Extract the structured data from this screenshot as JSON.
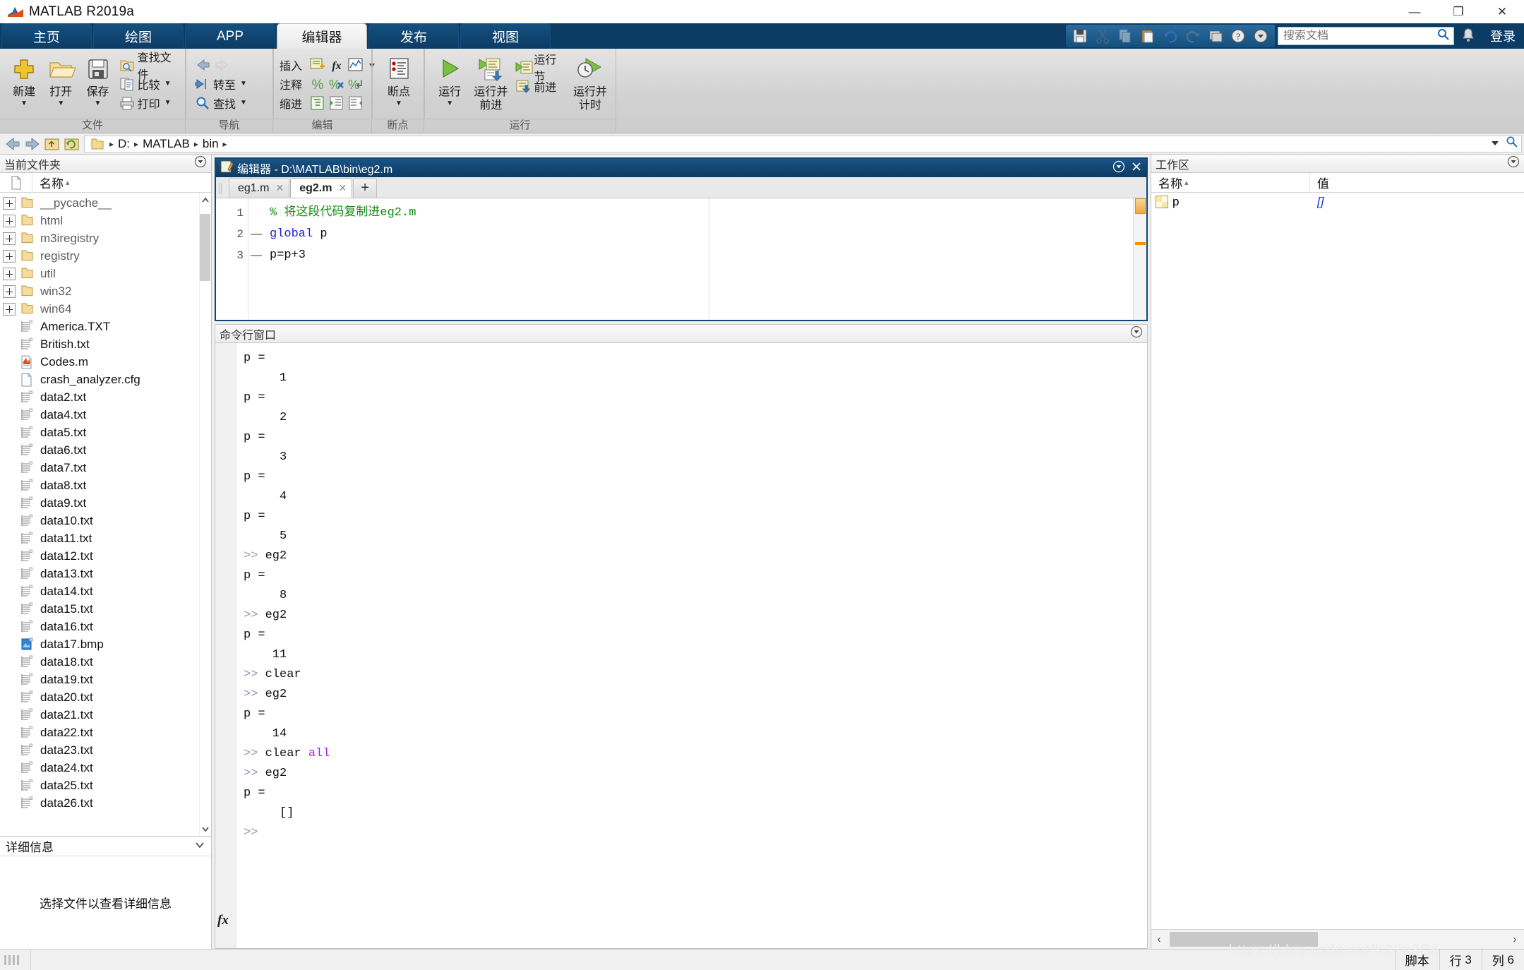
{
  "window": {
    "title": "MATLAB R2019a",
    "minimize": "—",
    "maximize": "❐",
    "close": "✕"
  },
  "ribbon": {
    "tabs": [
      {
        "label": "主页",
        "active": false
      },
      {
        "label": "绘图",
        "active": false
      },
      {
        "label": "APP",
        "active": false
      },
      {
        "label": "编辑器",
        "active": true
      },
      {
        "label": "发布",
        "active": false
      },
      {
        "label": "视图",
        "active": false
      }
    ],
    "quick_access": {
      "icons": [
        "save-icon",
        "cut-icon",
        "copy-icon",
        "paste-icon",
        "undo-icon",
        "redo-icon",
        "layout-icon",
        "help-icon",
        "more-icon"
      ],
      "search_placeholder": "搜索文档",
      "search_value": "",
      "notify_icon": "bell-icon",
      "login_label": "登录"
    },
    "groups": [
      {
        "name": "文件",
        "big_buttons": [
          {
            "label": "新建",
            "icon": "new-file-icon",
            "caret": "▼"
          },
          {
            "label": "打开",
            "icon": "open-folder-icon",
            "caret": "▼"
          },
          {
            "label": "保存",
            "icon": "save-disk-icon",
            "caret": "▼"
          }
        ],
        "small_buttons": [
          {
            "label": "查找文件",
            "icon": "find-files-icon",
            "caret": ""
          },
          {
            "label": "比较",
            "icon": "compare-icon",
            "caret": "▼"
          },
          {
            "label": "打印",
            "icon": "print-icon",
            "caret": "▼"
          }
        ]
      },
      {
        "name": "导航",
        "small_buttons": [
          {
            "label": "",
            "icon": "back-arrow-icon",
            "caret": ""
          },
          {
            "label": "转至",
            "icon": "goto-icon",
            "caret": "▼"
          },
          {
            "label": "查找",
            "icon": "search-icon",
            "caret": "▼"
          }
        ]
      },
      {
        "name": "编辑",
        "rows": [
          {
            "label": "插入",
            "icons": [
              "insert-section-icon",
              "fx-icon",
              "function-plot-icon",
              "chevron-down-icon"
            ]
          },
          {
            "label": "注释",
            "icons": [
              "comment-icon",
              "uncomment-icon",
              "wrap-comment-icon"
            ]
          },
          {
            "label": "缩进",
            "icons": [
              "smart-indent-icon",
              "indent-right-icon",
              "indent-left-icon"
            ]
          }
        ]
      },
      {
        "name": "断点",
        "big_buttons": [
          {
            "label": "断点",
            "icon": "breakpoint-icon",
            "caret": "▼"
          }
        ]
      },
      {
        "name": "运行",
        "big_buttons": [
          {
            "label": "运行",
            "icon": "run-icon",
            "caret": "▼"
          },
          {
            "label": "运行并\n前进",
            "icon": "run-advance-icon",
            "caret": ""
          },
          {
            "label": "运行并\n计时",
            "icon": "run-time-icon",
            "caret": ""
          }
        ],
        "small_buttons": [
          {
            "label": "运行节",
            "icon": "run-section-icon",
            "caret": ""
          },
          {
            "label": "前进",
            "icon": "advance-icon",
            "caret": ""
          }
        ]
      }
    ]
  },
  "address_bar": {
    "back_icon": "back-icon",
    "forward_icon": "forward-icon",
    "up_icon": "up-folder-icon",
    "refresh_icon": "refresh-icon",
    "folder_icon": "folder-icon",
    "crumbs": [
      "D:",
      "MATLAB",
      "bin"
    ],
    "separator": "▸",
    "dropdown_icon": "chevron-down-icon",
    "browse_icon": "browse-icon"
  },
  "current_folder": {
    "title": "当前文件夹",
    "collapse_icon": "panel-menu-icon",
    "col_icon_header": "file-type-icon",
    "col_name": "名称",
    "sort_arrow": "▴",
    "items": [
      {
        "name": "__pycache__",
        "type": "folder",
        "expandable": true
      },
      {
        "name": "html",
        "type": "folder",
        "expandable": true
      },
      {
        "name": "m3iregistry",
        "type": "folder",
        "expandable": true
      },
      {
        "name": "registry",
        "type": "folder",
        "expandable": true
      },
      {
        "name": "util",
        "type": "folder",
        "expandable": true
      },
      {
        "name": "win32",
        "type": "folder",
        "expandable": true
      },
      {
        "name": "win64",
        "type": "folder",
        "expandable": true
      },
      {
        "name": "America.TXT",
        "type": "txt",
        "expandable": false
      },
      {
        "name": "British.txt",
        "type": "txt",
        "expandable": false
      },
      {
        "name": "Codes.m",
        "type": "m",
        "expandable": false
      },
      {
        "name": "crash_analyzer.cfg",
        "type": "cfg",
        "expandable": false
      },
      {
        "name": "data2.txt",
        "type": "txt",
        "expandable": false
      },
      {
        "name": "data4.txt",
        "type": "txt",
        "expandable": false
      },
      {
        "name": "data5.txt",
        "type": "txt",
        "expandable": false
      },
      {
        "name": "data6.txt",
        "type": "txt",
        "expandable": false
      },
      {
        "name": "data7.txt",
        "type": "txt",
        "expandable": false
      },
      {
        "name": "data8.txt",
        "type": "txt",
        "expandable": false
      },
      {
        "name": "data9.txt",
        "type": "txt",
        "expandable": false
      },
      {
        "name": "data10.txt",
        "type": "txt",
        "expandable": false
      },
      {
        "name": "data11.txt",
        "type": "txt",
        "expandable": false
      },
      {
        "name": "data12.txt",
        "type": "txt",
        "expandable": false
      },
      {
        "name": "data13.txt",
        "type": "txt",
        "expandable": false
      },
      {
        "name": "data14.txt",
        "type": "txt",
        "expandable": false
      },
      {
        "name": "data15.txt",
        "type": "txt",
        "expandable": false
      },
      {
        "name": "data16.txt",
        "type": "txt",
        "expandable": false
      },
      {
        "name": "data17.bmp",
        "type": "bmp",
        "expandable": false
      },
      {
        "name": "data18.txt",
        "type": "txt",
        "expandable": false
      },
      {
        "name": "data19.txt",
        "type": "txt",
        "expandable": false
      },
      {
        "name": "data20.txt",
        "type": "txt",
        "expandable": false
      },
      {
        "name": "data21.txt",
        "type": "txt",
        "expandable": false
      },
      {
        "name": "data22.txt",
        "type": "txt",
        "expandable": false
      },
      {
        "name": "data23.txt",
        "type": "txt",
        "expandable": false
      },
      {
        "name": "data24.txt",
        "type": "txt",
        "expandable": false
      },
      {
        "name": "data25.txt",
        "type": "txt",
        "expandable": false
      },
      {
        "name": "data26.txt",
        "type": "txt",
        "expandable": false
      }
    ]
  },
  "details_panel": {
    "title": "详细信息",
    "collapse_icon": "chevron-down-icon",
    "empty_text": "选择文件以查看详细信息"
  },
  "editor": {
    "title": "编辑器 - D:\\MATLAB\\bin\\eg2.m",
    "icon": "editor-icon",
    "menu_icon": "panel-menu-icon",
    "close_icon": "close-icon",
    "tabs": [
      {
        "label": "eg1.m",
        "active": false,
        "close": "✕"
      },
      {
        "label": "eg2.m",
        "active": true,
        "close": "✕"
      }
    ],
    "new_tab_label": "+",
    "lines": [
      {
        "num": "1",
        "bp": "",
        "segments": [
          {
            "text": "% 将这段代码复制进eg2.m",
            "cls": "c-comment"
          }
        ]
      },
      {
        "num": "2",
        "bp": "—",
        "segments": [
          {
            "text": "global",
            "cls": "c-key"
          },
          {
            "text": " p",
            "cls": "c-var"
          }
        ]
      },
      {
        "num": "3",
        "bp": "—",
        "segments": [
          {
            "text": "p=p+3",
            "cls": "c-var"
          }
        ]
      }
    ]
  },
  "command_window": {
    "title": "命令行窗口",
    "collapse_icon": "panel-menu-icon",
    "prompt": ">>",
    "fx_icon": "fx-icon",
    "lines": [
      {
        "type": "out",
        "text": "p ="
      },
      {
        "type": "val",
        "text": "1"
      },
      {
        "type": "out",
        "text": "p ="
      },
      {
        "type": "val",
        "text": "2"
      },
      {
        "type": "out",
        "text": "p ="
      },
      {
        "type": "val",
        "text": "3"
      },
      {
        "type": "out",
        "text": "p ="
      },
      {
        "type": "val",
        "text": "4"
      },
      {
        "type": "out",
        "text": "p ="
      },
      {
        "type": "val",
        "text": "5"
      },
      {
        "type": "cmd",
        "text": "eg2"
      },
      {
        "type": "out",
        "text": "p ="
      },
      {
        "type": "val",
        "text": "8"
      },
      {
        "type": "cmd",
        "text": "eg2"
      },
      {
        "type": "out",
        "text": "p ="
      },
      {
        "type": "val2",
        "text": "11"
      },
      {
        "type": "cmd",
        "text": "clear"
      },
      {
        "type": "cmd",
        "text": "eg2"
      },
      {
        "type": "out",
        "text": "p ="
      },
      {
        "type": "val2",
        "text": "14"
      },
      {
        "type": "cmd_kw",
        "text": "clear ",
        "kw": "all"
      },
      {
        "type": "cmd",
        "text": "eg2"
      },
      {
        "type": "out",
        "text": "p ="
      },
      {
        "type": "val",
        "text": "[]"
      },
      {
        "type": "prompt_only",
        "text": ""
      }
    ]
  },
  "workspace": {
    "title": "工作区",
    "collapse_icon": "panel-menu-icon",
    "col_name": "名称",
    "col_value": "值",
    "sort_arrow": "▴",
    "rows": [
      {
        "name": "p",
        "value": "[]",
        "icon": "matrix-icon"
      }
    ],
    "hscroll_left": "‹",
    "hscroll_right": "›"
  },
  "status_bar": {
    "script_label": "脚本",
    "line_label": "行",
    "line_value": "3",
    "col_label": "列",
    "col_value": "6",
    "watermark": "https://blog.csdn.net/K2Fn3C6"
  },
  "colors": {
    "ribbon_blue": "#0f4677",
    "title_dark": "#0c3c63",
    "accent_orange": "#f39200",
    "comment_green": "#168c16",
    "keyword_blue": "#1f1fd1",
    "keyword_purple": "#a020f0",
    "value_blue": "#1433c4"
  }
}
